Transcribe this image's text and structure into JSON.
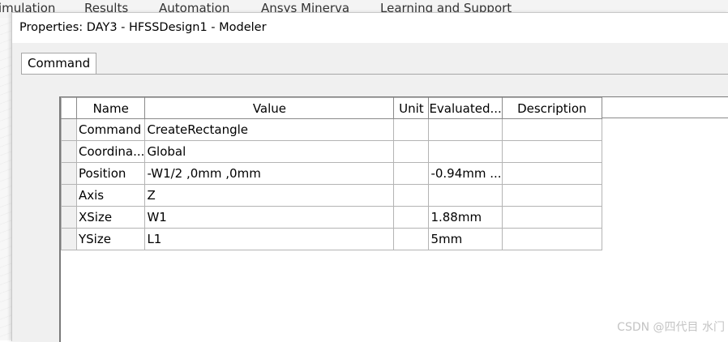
{
  "ribbon": {
    "items": [
      "imulation",
      "Results",
      "Automation",
      "Ansys Minerva",
      "Learning and Support"
    ]
  },
  "dialog": {
    "title": "Properties: DAY3 - HFSSDesign1 - Modeler",
    "tab_label": "Command"
  },
  "grid": {
    "headers": [
      "Name",
      "Value",
      "Unit",
      "Evaluated...",
      "Description"
    ],
    "rows": [
      {
        "name": "Command",
        "value": "CreateRectangle",
        "unit": "",
        "evaluated": "",
        "description": ""
      },
      {
        "name": "Coordina...",
        "value": "Global",
        "unit": "",
        "evaluated": "",
        "description": ""
      },
      {
        "name": "Position",
        "value": "-W1/2 ,0mm ,0mm",
        "unit": "",
        "evaluated": "-0.94mm ...",
        "description": ""
      },
      {
        "name": "Axis",
        "value": "Z",
        "unit": "",
        "evaluated": "",
        "description": ""
      },
      {
        "name": "XSize",
        "value": "W1",
        "unit": "",
        "evaluated": "1.88mm",
        "description": ""
      },
      {
        "name": "YSize",
        "value": "L1",
        "unit": "",
        "evaluated": "5mm",
        "description": ""
      }
    ]
  },
  "watermark": "CSDN @四代目 水门"
}
